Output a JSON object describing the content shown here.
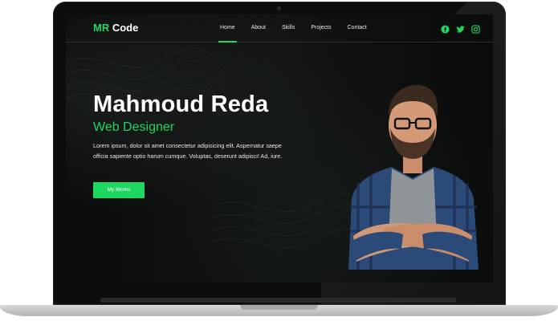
{
  "logo": {
    "accent": "MR",
    "rest": " Code"
  },
  "nav": {
    "items": [
      "Home",
      "About",
      "Skills",
      "Projects",
      "Contact"
    ],
    "active": "Home"
  },
  "social": [
    "facebook-icon",
    "twitter-icon",
    "instagram-icon"
  ],
  "hero": {
    "name": "Mahmoud Reda",
    "role": "Web Designer",
    "description": "Lorem ipsum, dolor sit amet consectetur adipisicing elit. Aspernatur saepe officia sapiente optio harum cumque. Voluptas, deserunt adipisci! Ad, iure.",
    "button": "My Works"
  },
  "colors": {
    "accent": "#1ed760",
    "background": "#0b0c0c",
    "text": "#ffffff"
  }
}
